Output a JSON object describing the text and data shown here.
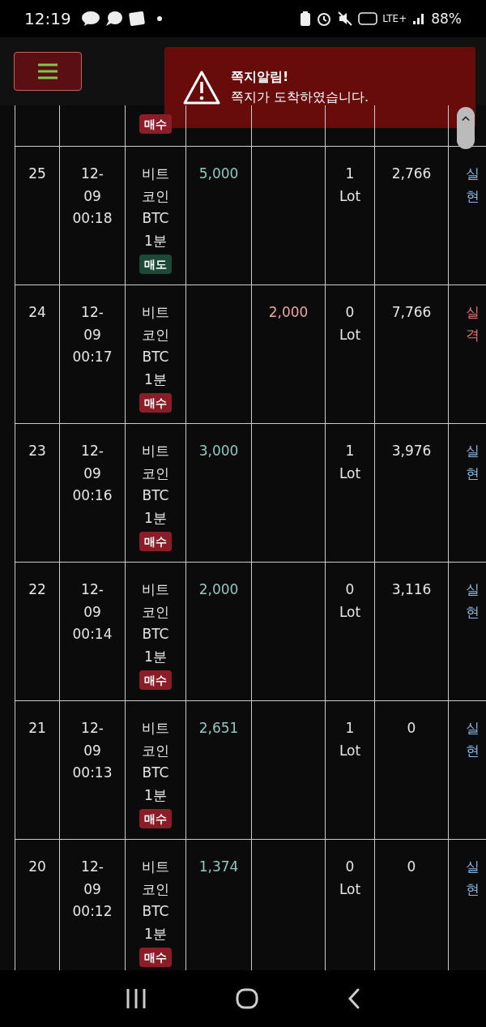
{
  "status_bar": {
    "time": "12:19",
    "network": "LTE+",
    "battery": "88%"
  },
  "toast": {
    "title": "쪽지알림!",
    "message": "쪽지가 도착하였습니다."
  },
  "partial_row": {
    "side": {
      "kind": "buy",
      "label": "매수"
    }
  },
  "rows": [
    {
      "no": "25",
      "date": "12-09",
      "time": "00:18",
      "name": "비트코인",
      "code": "BTC",
      "period": "1분",
      "side": {
        "kind": "sell",
        "label": "매도"
      },
      "profit": "5,000",
      "loss": "",
      "lots": "1 Lot",
      "balance": "2,766",
      "result": {
        "kind": "realized",
        "label": "실현"
      }
    },
    {
      "no": "24",
      "date": "12-09",
      "time": "00:17",
      "name": "비트코인",
      "code": "BTC",
      "period": "1분",
      "side": {
        "kind": "buy",
        "label": "매수"
      },
      "profit": "",
      "loss": "2,000",
      "lots": "0 Lot",
      "balance": "7,766",
      "result": {
        "kind": "failed",
        "label": "실격"
      }
    },
    {
      "no": "23",
      "date": "12-09",
      "time": "00:16",
      "name": "비트코인",
      "code": "BTC",
      "period": "1분",
      "side": {
        "kind": "buy",
        "label": "매수"
      },
      "profit": "3,000",
      "loss": "",
      "lots": "1 Lot",
      "balance": "3,976",
      "result": {
        "kind": "realized",
        "label": "실현"
      }
    },
    {
      "no": "22",
      "date": "12-09",
      "time": "00:14",
      "name": "비트코인",
      "code": "BTC",
      "period": "1분",
      "side": {
        "kind": "buy",
        "label": "매수"
      },
      "profit": "2,000",
      "loss": "",
      "lots": "0 Lot",
      "balance": "3,116",
      "result": {
        "kind": "realized",
        "label": "실현"
      }
    },
    {
      "no": "21",
      "date": "12-09",
      "time": "00:13",
      "name": "비트코인",
      "code": "BTC",
      "period": "1분",
      "side": {
        "kind": "buy",
        "label": "매수"
      },
      "profit": "2,651",
      "loss": "",
      "lots": "1 Lot",
      "balance": "0",
      "result": {
        "kind": "realized",
        "label": "실현"
      }
    },
    {
      "no": "20",
      "date": "12-09",
      "time": "00:12",
      "name": "비트코인",
      "code": "BTC",
      "period": "1분",
      "side": {
        "kind": "buy",
        "label": "매수"
      },
      "profit": "1,374",
      "loss": "",
      "lots": "0 Lot",
      "balance": "0",
      "result": {
        "kind": "realized",
        "label": "실현"
      }
    }
  ]
}
